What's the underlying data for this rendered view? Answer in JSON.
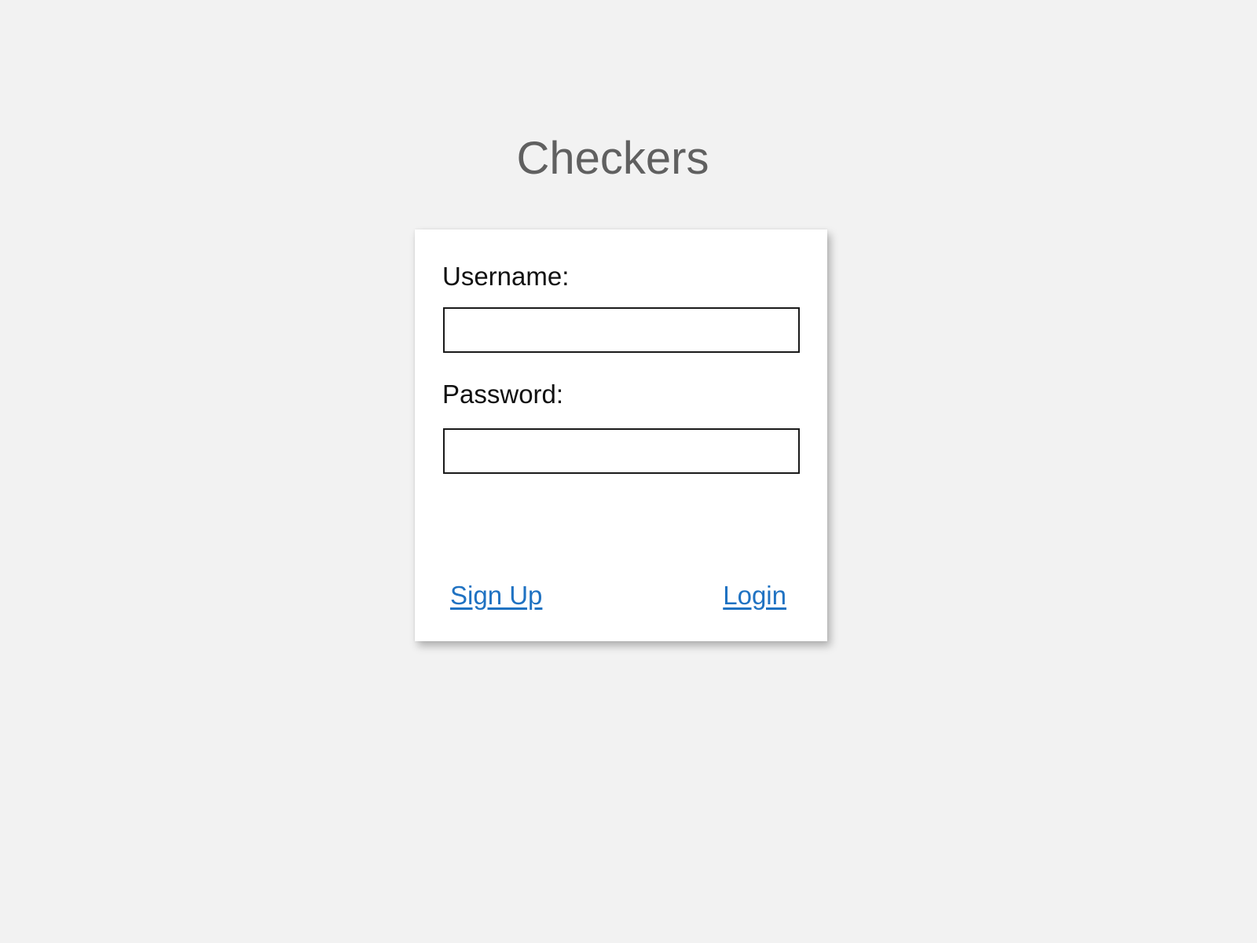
{
  "app": {
    "title": "Checkers"
  },
  "login_form": {
    "username_label": "Username:",
    "username_value": "",
    "password_label": "Password:",
    "password_value": "",
    "signup_link": "Sign Up",
    "login_link": "Login"
  },
  "colors": {
    "background": "#f2f2f2",
    "card": "#ffffff",
    "title_text": "#606060",
    "link": "#1f72c2"
  }
}
